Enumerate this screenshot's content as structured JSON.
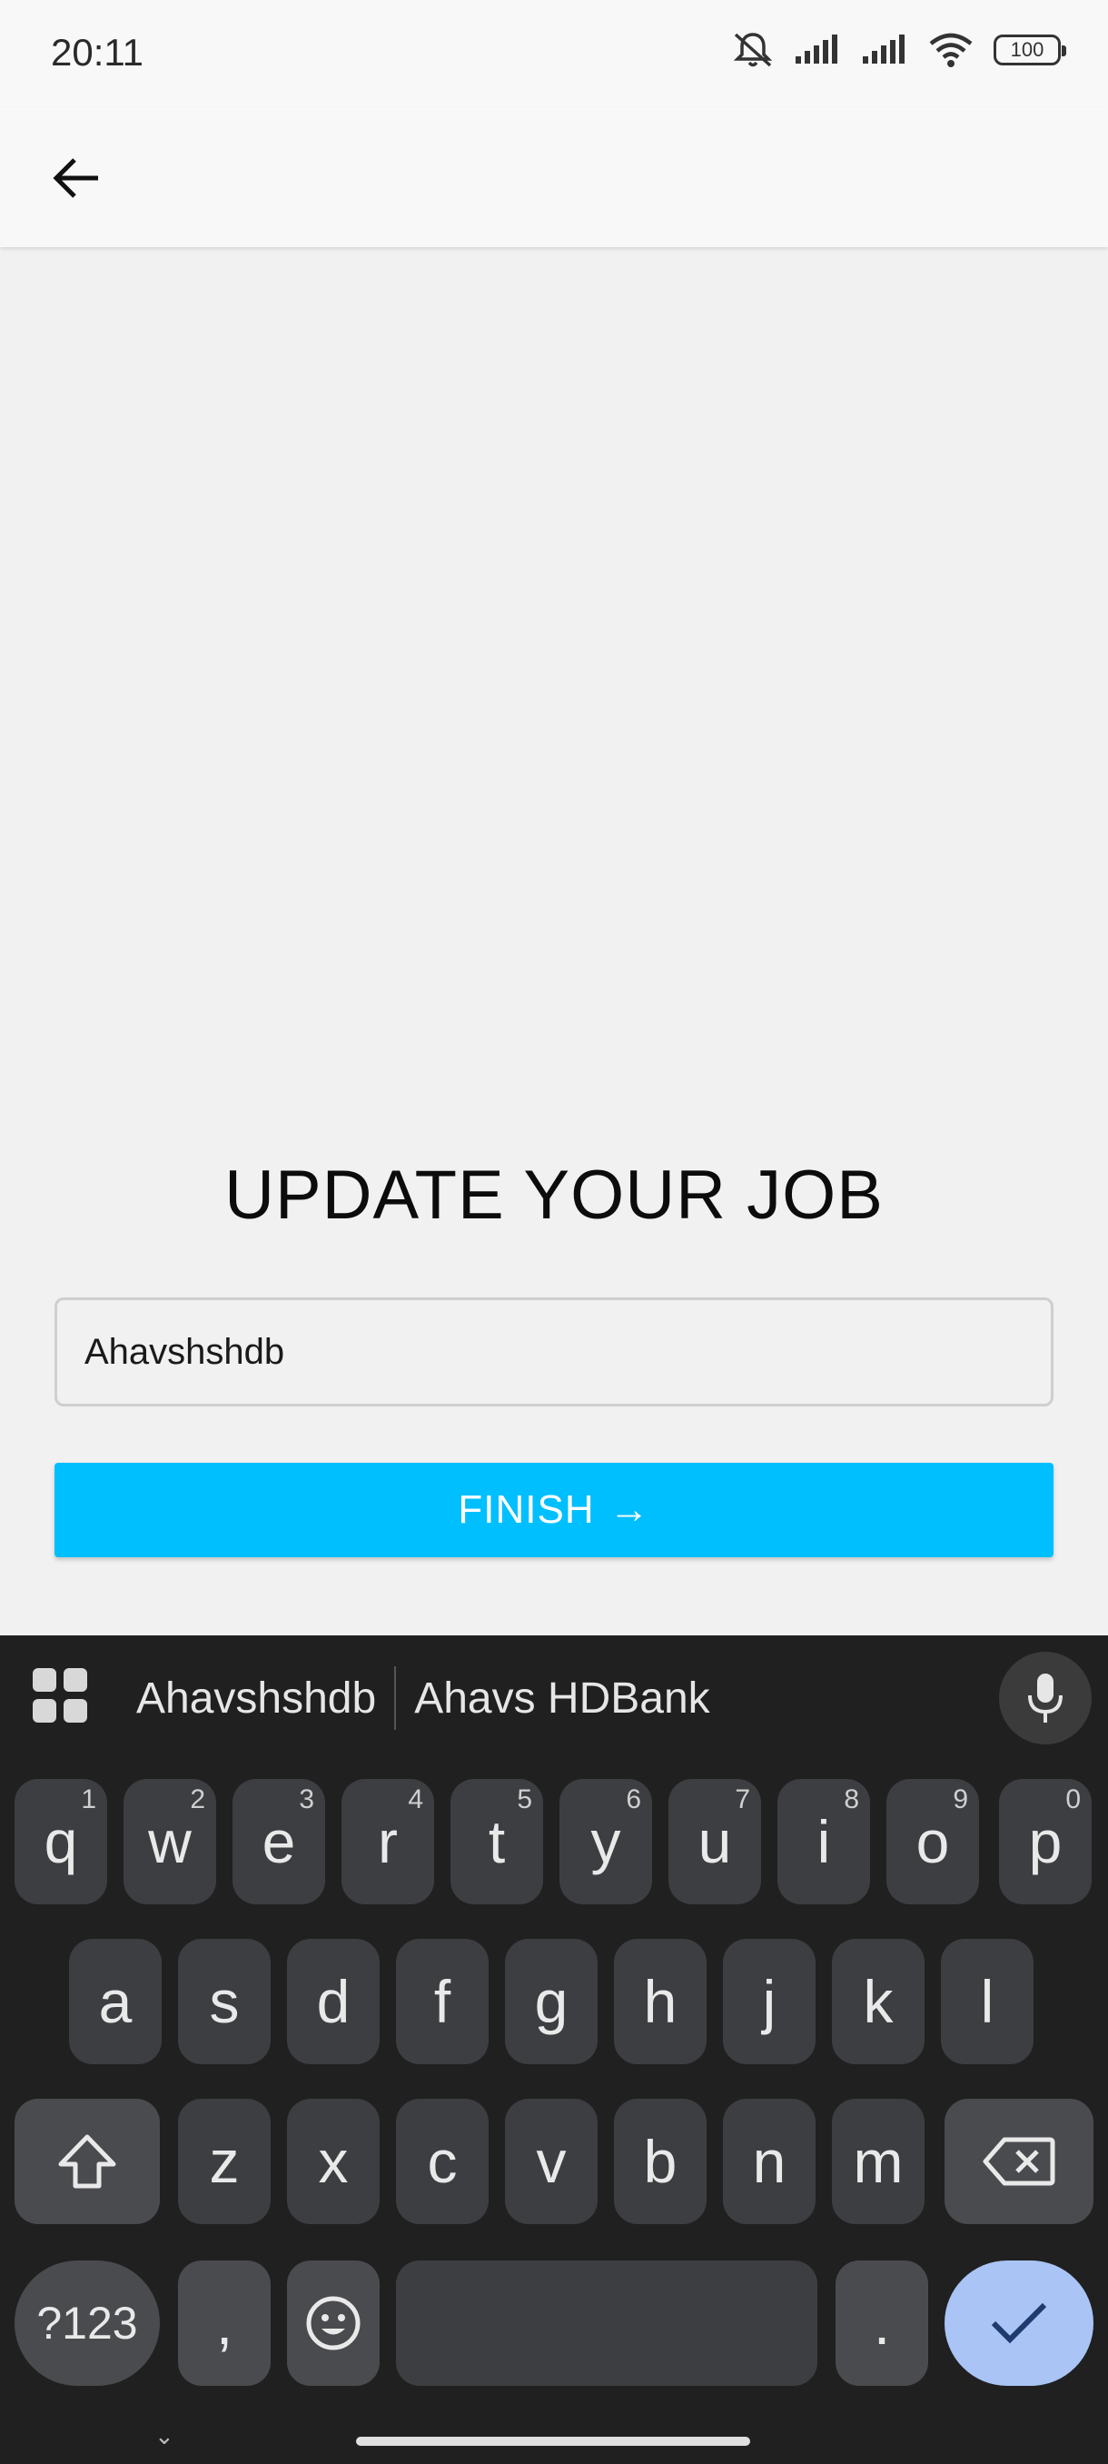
{
  "status_bar": {
    "time": "20:11",
    "icons": [
      "mute-icon",
      "signal-icon",
      "signal-icon",
      "wifi-icon"
    ],
    "battery": "100"
  },
  "app_bar": {
    "back_icon": "arrow-left-icon"
  },
  "main": {
    "title": "UPDATE YOUR JOB",
    "job_input_value": "Ahavshshdb",
    "finish_label": "FINISH",
    "finish_arrow": "→"
  },
  "keyboard": {
    "suggestions": [
      "Ahavshshdb",
      "Ahavs HDBank"
    ],
    "row1": [
      {
        "k": "q",
        "h": "1"
      },
      {
        "k": "w",
        "h": "2"
      },
      {
        "k": "e",
        "h": "3"
      },
      {
        "k": "r",
        "h": "4"
      },
      {
        "k": "t",
        "h": "5"
      },
      {
        "k": "y",
        "h": "6"
      },
      {
        "k": "u",
        "h": "7"
      },
      {
        "k": "i",
        "h": "8"
      },
      {
        "k": "o",
        "h": "9"
      },
      {
        "k": "p",
        "h": "0"
      }
    ],
    "row2": [
      "a",
      "s",
      "d",
      "f",
      "g",
      "h",
      "j",
      "k",
      "l"
    ],
    "row3": [
      "z",
      "x",
      "c",
      "v",
      "b",
      "n",
      "m"
    ],
    "symbols_label": "?123",
    "comma_label": ",",
    "period_label": ".",
    "enter_color": "#a9c4f5"
  }
}
